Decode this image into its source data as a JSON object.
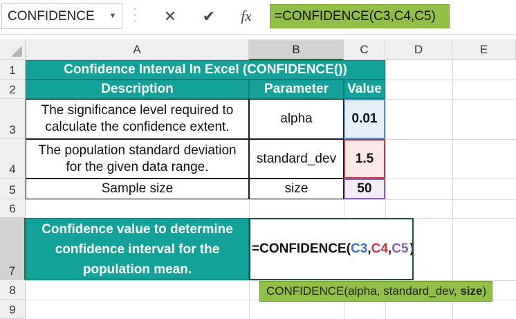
{
  "formula_bar": {
    "name_box": "CONFIDENCE",
    "cancel_glyph": "✕",
    "enter_glyph": "✔",
    "fx_label": "fx",
    "formula": "=CONFIDENCE(C3,C4,C5)"
  },
  "columns": [
    "A",
    "B",
    "C",
    "D",
    "E"
  ],
  "rows": [
    "1",
    "2",
    "3",
    "4",
    "5",
    "6",
    "7",
    "8",
    "9"
  ],
  "sheet": {
    "title": "Confidence Interval In Excel (CONFIDENCE())",
    "headers": {
      "description": "Description",
      "parameter": "Parameter",
      "value": "Value"
    },
    "rows": [
      {
        "description": "The significance level required to calculate the confidence extent.",
        "parameter": "alpha",
        "value": "0.01"
      },
      {
        "description": "The population standard deviation for the given data range.",
        "parameter": "standard_dev",
        "value": "1.5"
      },
      {
        "description": "Sample size",
        "parameter": "size",
        "value": "50"
      }
    ],
    "result_label": "Confidence value to determine confidence interval for the population mean.",
    "formula_edit": {
      "prefix": "=CONFIDENCE(",
      "ref1": "C3",
      "sep1": ",",
      "ref2": "C4",
      "sep2": ",",
      "ref3": "C5",
      "suffix": ")"
    }
  },
  "tooltip": {
    "func": "CONFIDENCE(",
    "args_plain": "alpha, standard_dev, ",
    "arg_active": "size",
    "close": ")"
  },
  "colors": {
    "header_fill": "#12a19b",
    "formula_bar_fill": "#92c046",
    "ref_c3": "#3f6fc6",
    "ref_c4": "#c8343f",
    "ref_c5": "#8e5cbd"
  }
}
